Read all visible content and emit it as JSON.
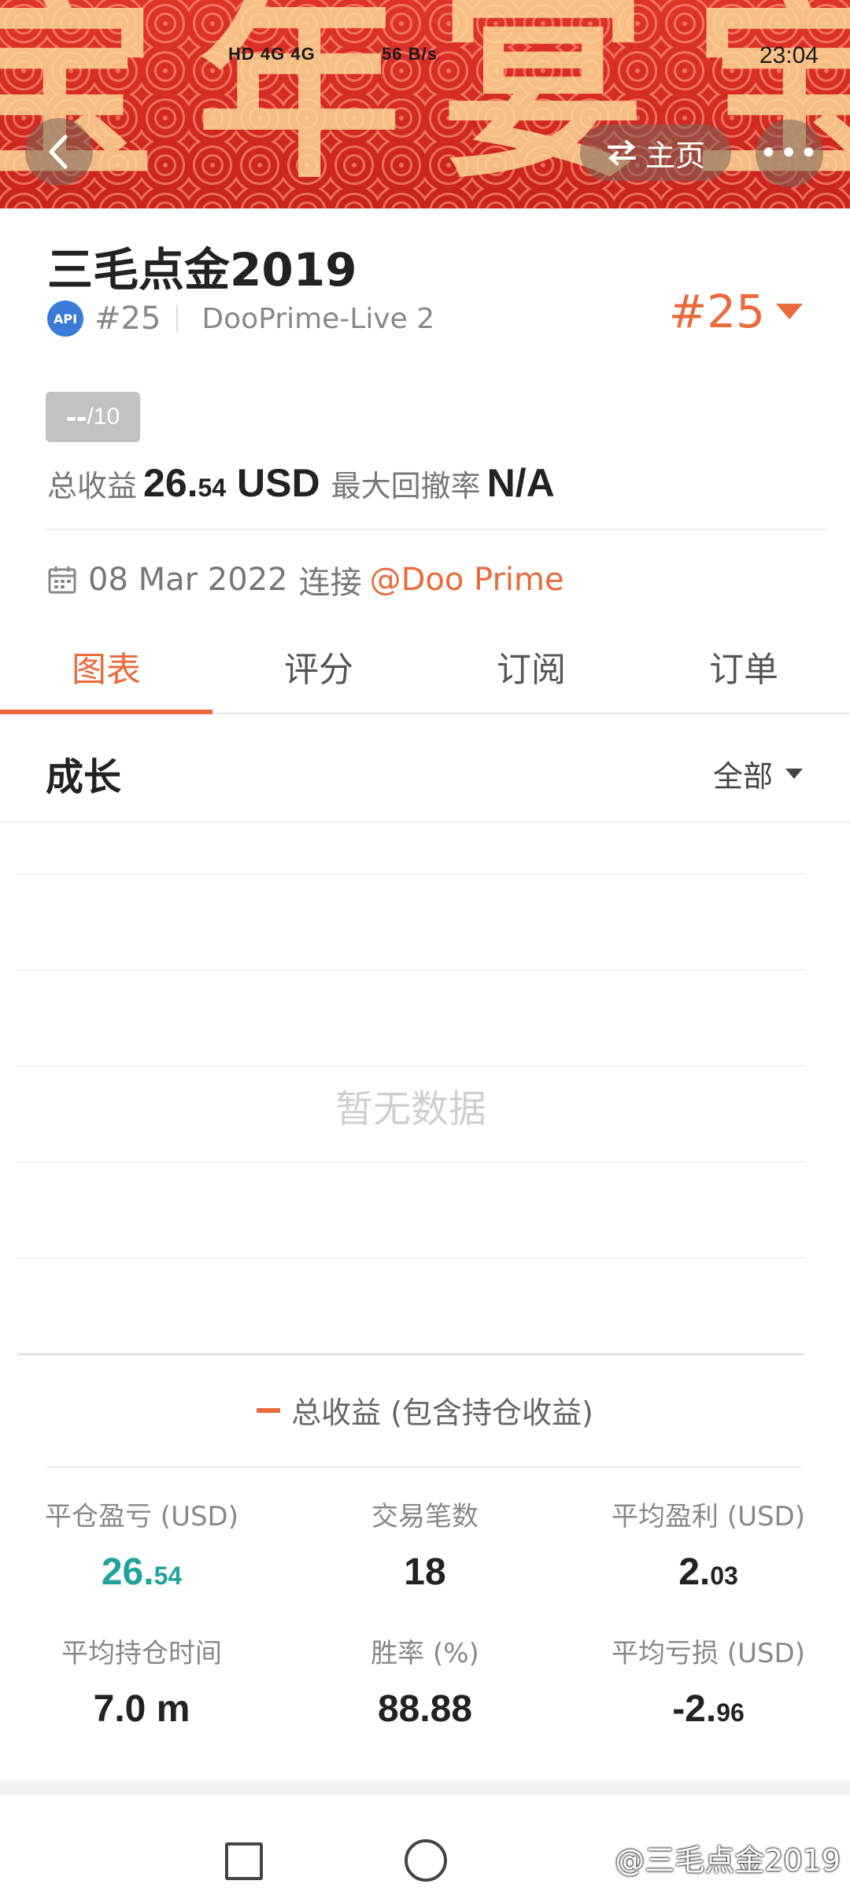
{
  "status_bar": {
    "network": "HD 4G 4G",
    "speed": "56 B/s",
    "time": "23:04"
  },
  "header": {
    "home_label": "主页",
    "more_label": "•••"
  },
  "profile": {
    "name": "三毛点金2019",
    "api_badge": "API",
    "rank_id": "#25",
    "server": "DooPrime-Live 2",
    "rank_right": "#25"
  },
  "score": {
    "value": "--",
    "out_of": "/10"
  },
  "metrics": {
    "total_profit_label": "总收益",
    "total_profit_int": "26.",
    "total_profit_dec": "54",
    "total_profit_unit": "USD",
    "drawdown_label": "最大回撤率",
    "drawdown_value": "N/A"
  },
  "since": {
    "date": "08 Mar 2022",
    "connect_label": "连接",
    "broker": "@Doo Prime"
  },
  "tabs": [
    {
      "label": "图表"
    },
    {
      "label": "评分"
    },
    {
      "label": "订阅"
    },
    {
      "label": "订单"
    }
  ],
  "growth": {
    "title": "成长",
    "filter": "全部",
    "empty_text": "暂无数据",
    "legend": "总收益 (包含持仓收益)"
  },
  "stats": [
    {
      "label": "平仓盈亏 (USD)",
      "int": "26.",
      "dec": "54",
      "color": "#1fa39a"
    },
    {
      "label": "交易笔数",
      "int": "18",
      "dec": ""
    },
    {
      "label": "平均盈利 (USD)",
      "int": "2.",
      "dec": "03"
    },
    {
      "label": "平均持仓时间",
      "int": "7.0 m",
      "dec": ""
    },
    {
      "label": "胜率 (%)",
      "int": "88.88",
      "dec": ""
    },
    {
      "label": "平均亏损 (USD)",
      "int": "-2.",
      "dec": "96"
    }
  ],
  "watermark": "@三毛点金2019"
}
